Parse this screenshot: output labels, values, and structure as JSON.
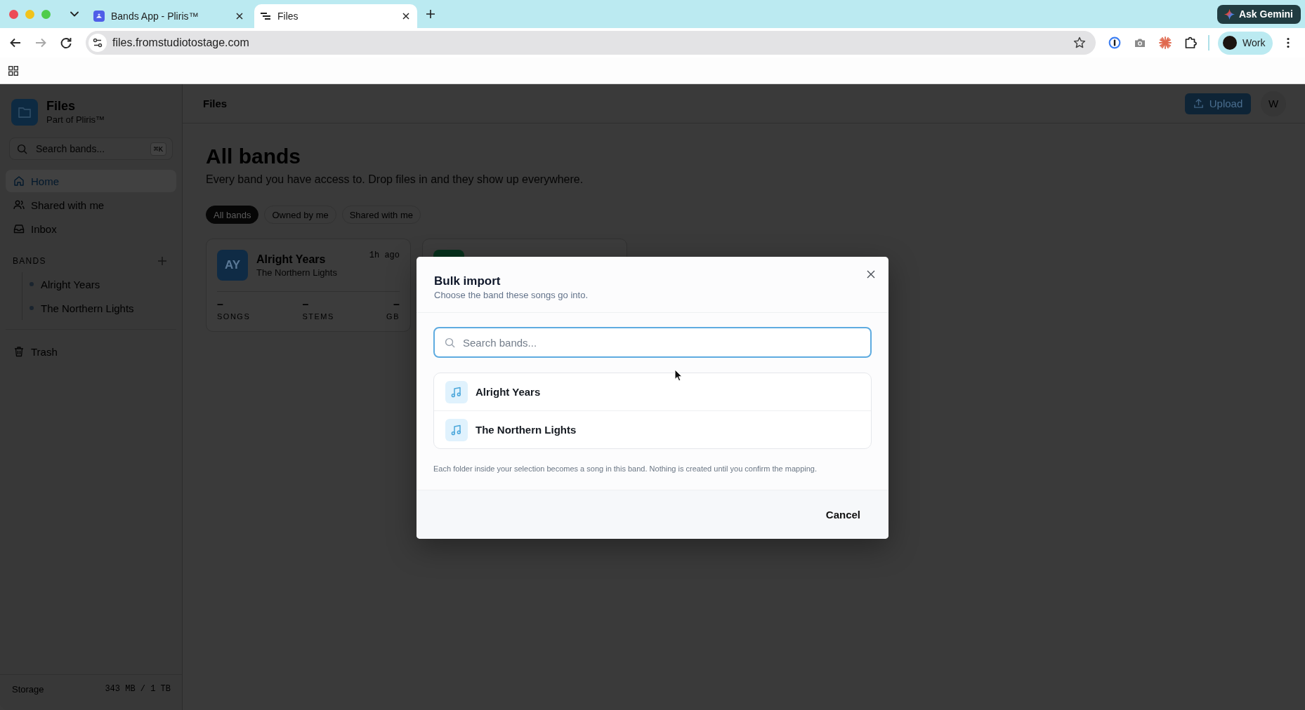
{
  "browser": {
    "tabs": [
      {
        "title": "Bands App - Pliris™",
        "selected": false
      },
      {
        "title": "Files",
        "selected": true
      }
    ],
    "assistant_button": "Ask Gemini",
    "address": "files.fromstudiotostage.com",
    "profile": "Work"
  },
  "sidebar": {
    "app_name": "Files",
    "app_subtitle": "Part of Pliris™",
    "search": {
      "placeholder": "Search bands...",
      "shortcut": "⌘K"
    },
    "nav": [
      {
        "label": "Home",
        "selected": true
      },
      {
        "label": "Shared with me",
        "selected": false
      },
      {
        "label": "Inbox",
        "selected": false
      }
    ],
    "bands_heading": "BANDS",
    "bands": [
      "Alright Years",
      "The Northern Lights"
    ],
    "trash": "Trash",
    "storage": {
      "label": "Storage",
      "value": "343 MB / 1 TB"
    }
  },
  "header": {
    "title": "Files",
    "upload": "Upload",
    "avatar": "W"
  },
  "page": {
    "title": "All bands",
    "subtitle": "Every band you have access to. Drop files in and they show up everywhere.",
    "filters": [
      {
        "label": "All bands",
        "selected": true
      },
      {
        "label": "Owned by me",
        "selected": false
      },
      {
        "label": "Shared with me",
        "selected": false
      }
    ],
    "cards": [
      {
        "initials": "AY",
        "color": "#0f2b45",
        "name": "Alright Years",
        "owner": "The Northern Lights",
        "time": "1h ago",
        "stats": [
          {
            "value": "–",
            "label": "SONGS"
          },
          {
            "value": "–",
            "label": "STEMS"
          },
          {
            "value": "–",
            "label": "GB"
          }
        ]
      },
      {
        "color": "#06301c"
      }
    ]
  },
  "modal": {
    "title": "Bulk import",
    "subtitle": "Choose the band these songs go into.",
    "search": {
      "placeholder": "Search bands..."
    },
    "options": [
      "Alright Years",
      "The Northern Lights"
    ],
    "note": "Each folder inside your selection becomes a song in this band. Nothing is created until you confirm the mapping.",
    "cancel": "Cancel"
  }
}
